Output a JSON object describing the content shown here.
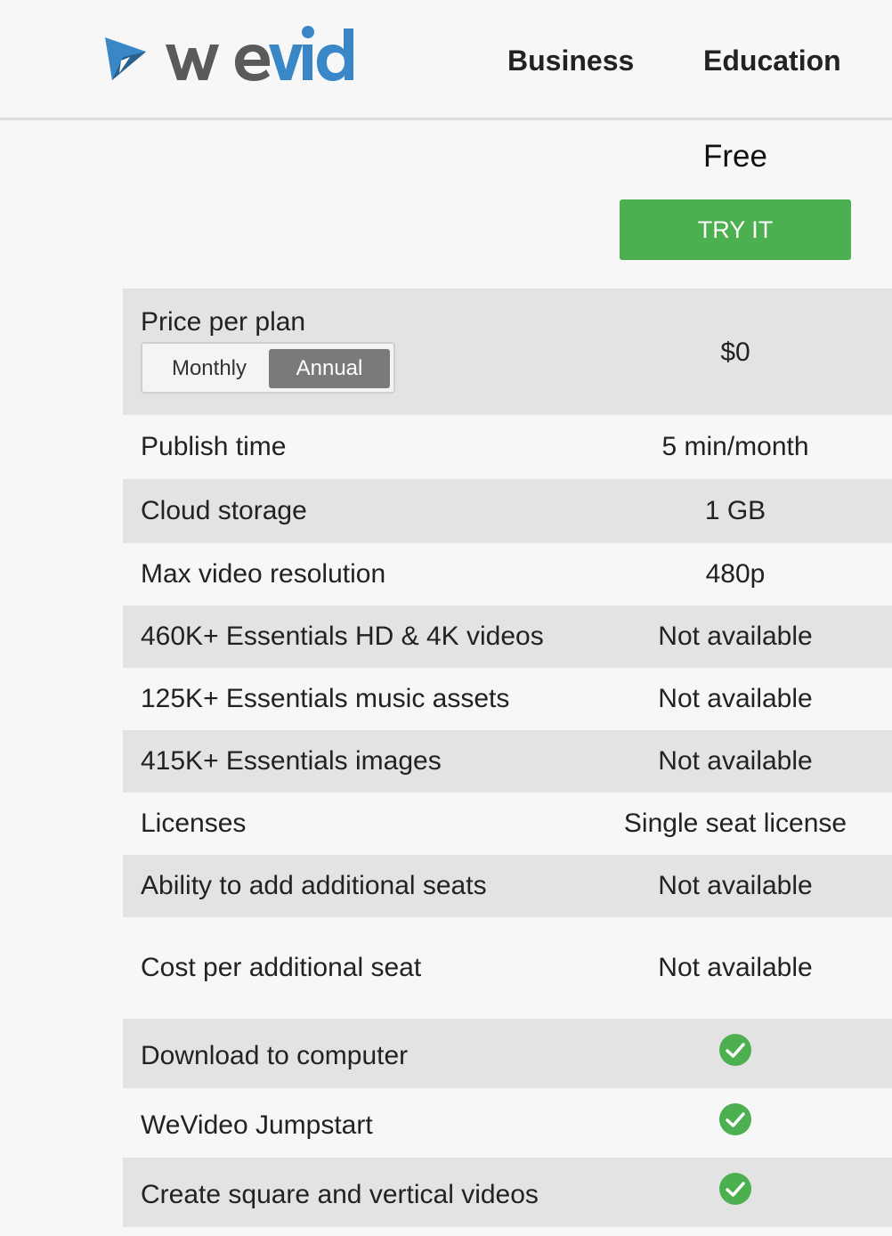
{
  "header": {
    "logo_text": "weVideo",
    "nav": [
      {
        "label": "Business"
      },
      {
        "label": "Education"
      }
    ]
  },
  "plan": {
    "name": "Free",
    "cta_label": "TRY IT"
  },
  "price_row": {
    "label": "Price per plan",
    "toggle": {
      "monthly_label": "Monthly",
      "annual_label": "Annual",
      "selected": "Annual"
    },
    "value": "$0"
  },
  "rows": [
    {
      "label": "Publish time",
      "value": "5 min/month"
    },
    {
      "label": "Cloud storage",
      "value": "1 GB"
    },
    {
      "label": "Max video resolution",
      "value": "480p"
    },
    {
      "label": "460K+ Essentials HD & 4K videos",
      "value": "Not available"
    },
    {
      "label": "125K+ Essentials music assets",
      "value": "Not available"
    },
    {
      "label": "415K+ Essentials images",
      "value": "Not available"
    },
    {
      "label": "Licenses",
      "value": "Single seat license"
    },
    {
      "label": "Ability to add additional seats",
      "value": "Not available"
    },
    {
      "label": "Cost per additional seat",
      "value": "Not available"
    },
    {
      "label": "Download to computer",
      "value": "included",
      "icon": "check-circle-icon"
    },
    {
      "label": "WeVideo Jumpstart",
      "value": "included",
      "icon": "check-circle-icon"
    },
    {
      "label": "Create square and vertical videos",
      "value": "included",
      "icon": "check-circle-icon"
    }
  ],
  "colors": {
    "accent_green": "#4caf50",
    "brand_blue": "#3a87c8",
    "brand_gray": "#5a5a5a",
    "row_shade": "#e3e3e3",
    "check_green": "#4caf50"
  }
}
